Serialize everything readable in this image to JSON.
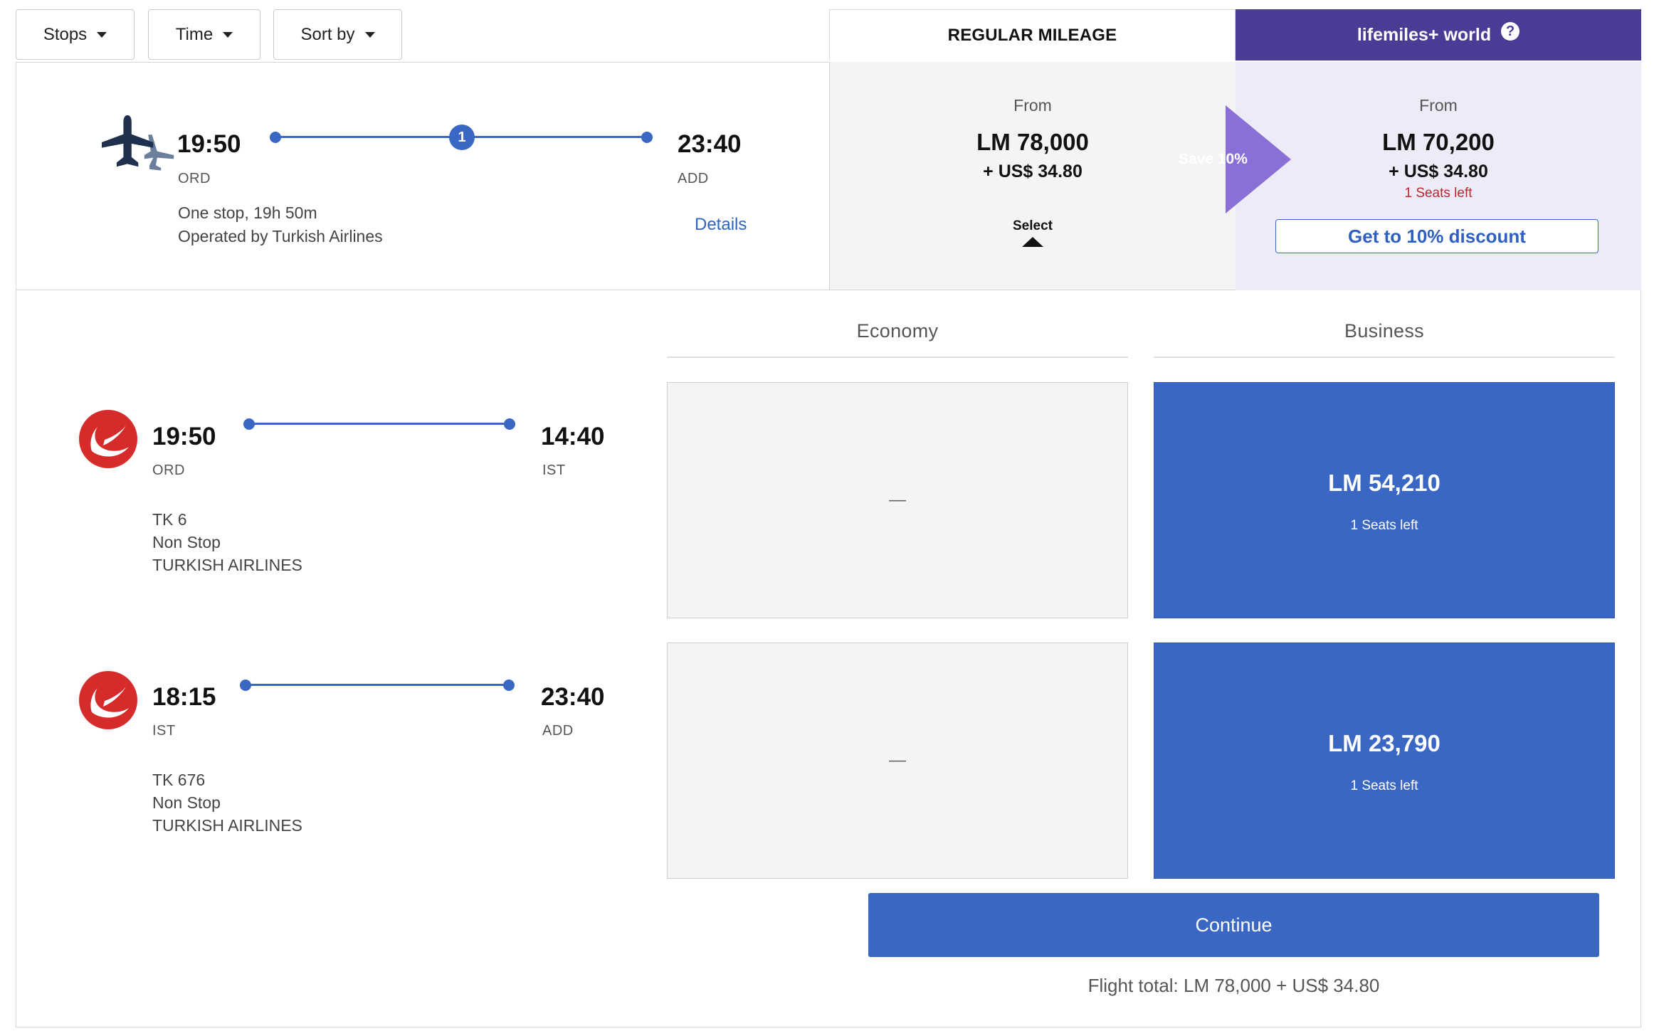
{
  "filters": {
    "stops_label": "Stops",
    "time_label": "Time",
    "sort_label": "Sort by"
  },
  "tabs": {
    "regular_label": "REGULAR MILEAGE",
    "world_label": "lifemiles+ world"
  },
  "summary": {
    "depart_time": "19:50",
    "depart_code": "ORD",
    "arrive_time": "23:40",
    "arrive_code": "ADD",
    "stops_count": "1",
    "stops_duration": "One stop, 19h 50m",
    "operator": "Operated by Turkish Airlines",
    "details_label": "Details"
  },
  "regular_price": {
    "from_label": "From",
    "lm": "LM 78,000",
    "usd": "+ US$ 34.80",
    "select_label": "Select"
  },
  "world_price": {
    "from_label": "From",
    "lm": "LM 70,200",
    "usd": "+ US$ 34.80",
    "seats": "1 Seats left",
    "discount_label": "Get to 10% discount",
    "save_label": "Save 10%"
  },
  "cabins": {
    "economy_label": "Economy",
    "business_label": "Business"
  },
  "segments": [
    {
      "depart_time": "19:50",
      "depart_code": "ORD",
      "arrive_time": "14:40",
      "arrive_code": "IST",
      "flight_no": "TK 6",
      "stops": "Non Stop",
      "airline": "TURKISH AIRLINES",
      "economy": "—",
      "business_price": "LM 54,210",
      "business_seats": "1 Seats left"
    },
    {
      "depart_time": "18:15",
      "depart_code": "IST",
      "arrive_time": "23:40",
      "arrive_code": "ADD",
      "flight_no": "TK 676",
      "stops": "Non Stop",
      "airline": "TURKISH AIRLINES",
      "economy": "—",
      "business_price": "LM 23,790",
      "business_seats": "1 Seats left"
    }
  ],
  "footer": {
    "continue_label": "Continue",
    "flight_total": "Flight total: LM 78,000 + US$ 34.80"
  },
  "colors": {
    "accent_blue": "#3a66c4",
    "world_purple": "#4a3b95",
    "save_purple": "#8a6fd6",
    "seats_red": "#c0262d"
  }
}
